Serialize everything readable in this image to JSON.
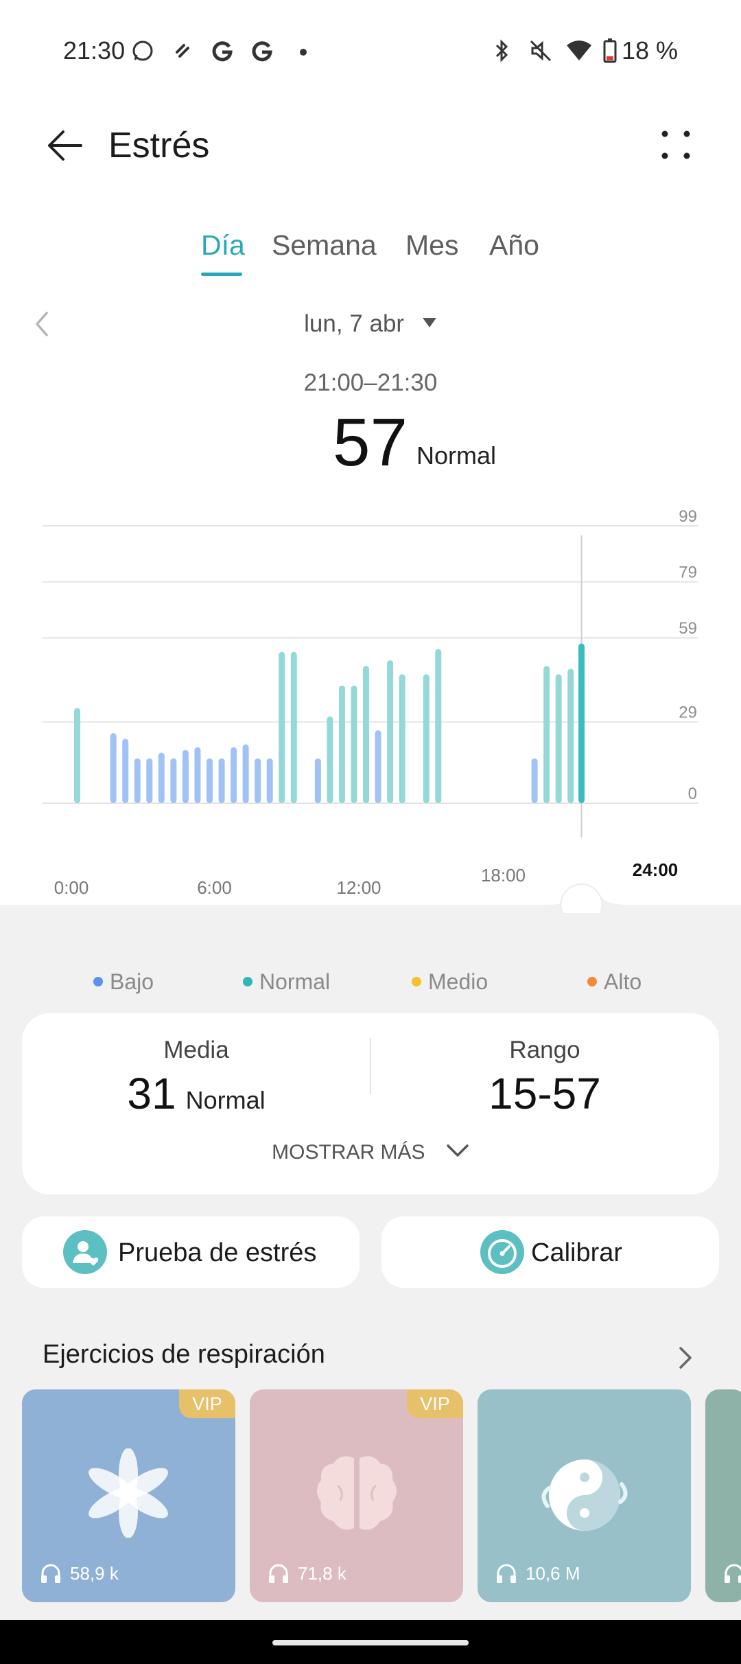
{
  "status_bar": {
    "time": "21:30",
    "battery": "18 %",
    "icons": [
      "whatsapp-icon",
      "tool-icon",
      "google-icon",
      "google-icon",
      "dot-icon",
      "bluetooth-icon",
      "mute-icon",
      "wifi-icon",
      "battery-icon"
    ]
  },
  "header": {
    "title": "Estrés"
  },
  "tabs": [
    {
      "label": "Día",
      "active": true
    },
    {
      "label": "Semana",
      "active": false
    },
    {
      "label": "Mes",
      "active": false
    },
    {
      "label": "Año",
      "active": false
    }
  ],
  "date_selector": {
    "label": "lun, 7 abr"
  },
  "selection": {
    "time_range": "21:00–21:30",
    "value": "57",
    "level": "Normal"
  },
  "chart_data": {
    "type": "bar",
    "y_ticks": [
      "99",
      "79",
      "59",
      "29",
      "0"
    ],
    "y_tick_values": [
      99,
      79,
      59,
      29,
      0
    ],
    "x_ticks": [
      "0:00",
      "6:00",
      "12:00",
      "18:00",
      "24:00"
    ],
    "x_tick_values": [
      0,
      6,
      12,
      18,
      24
    ],
    "xlim": [
      0,
      24
    ],
    "ylim": [
      0,
      99
    ],
    "selected_x": 21.25,
    "colors": {
      "bajo": "#a0c2f5",
      "normal": "#94d8d8",
      "selected": "#3cbcbd"
    },
    "series": [
      {
        "name": "Bajo",
        "points": [
          [
            1.8,
            25
          ],
          [
            2.3,
            23
          ],
          [
            2.8,
            16
          ],
          [
            3.3,
            16
          ],
          [
            3.8,
            18
          ],
          [
            4.3,
            16
          ],
          [
            4.8,
            19
          ],
          [
            5.3,
            20
          ],
          [
            5.8,
            16
          ],
          [
            6.3,
            16
          ],
          [
            6.8,
            20
          ],
          [
            7.3,
            21
          ],
          [
            7.8,
            16
          ],
          [
            8.3,
            16
          ],
          [
            10.3,
            16
          ],
          [
            12.8,
            26
          ],
          [
            19.3,
            16
          ]
        ],
        "level": "bajo"
      },
      {
        "name": "Normal",
        "points": [
          [
            0.3,
            34
          ],
          [
            8.8,
            54
          ],
          [
            9.3,
            54
          ],
          [
            10.8,
            31
          ],
          [
            11.3,
            42
          ],
          [
            11.8,
            42
          ],
          [
            12.3,
            49
          ],
          [
            13.3,
            51
          ],
          [
            13.8,
            46
          ],
          [
            14.8,
            46
          ],
          [
            15.3,
            55
          ],
          [
            19.8,
            49
          ],
          [
            20.3,
            46
          ],
          [
            20.8,
            48
          ],
          [
            21.25,
            57
          ]
        ],
        "level": "normal"
      }
    ]
  },
  "legend": [
    {
      "label": "Bajo",
      "color": "#5b8ff4"
    },
    {
      "label": "Normal",
      "color": "#2fb8b8"
    },
    {
      "label": "Medio",
      "color": "#f4c22a"
    },
    {
      "label": "Alto",
      "color": "#f28a3a"
    }
  ],
  "summary": {
    "mean_label": "Media",
    "mean_value": "31",
    "mean_level": "Normal",
    "range_label": "Rango",
    "range_value": "15-57",
    "show_more": "MOSTRAR MÁS"
  },
  "actions": {
    "stress_test": "Prueba de estrés",
    "calibrate": "Calibrar"
  },
  "breathing": {
    "title": "Ejercicios de respiración",
    "cards": [
      {
        "count": "58,9 k",
        "vip": "VIP",
        "icon": "flower-icon",
        "bg": "#8fb1d6"
      },
      {
        "count": "71,8 k",
        "vip": "VIP",
        "icon": "brain-icon",
        "bg": "#dcbcc0"
      },
      {
        "count": "10,6 M",
        "vip": "",
        "icon": "yin-yang-icon",
        "bg": "#97c0c8"
      }
    ]
  }
}
